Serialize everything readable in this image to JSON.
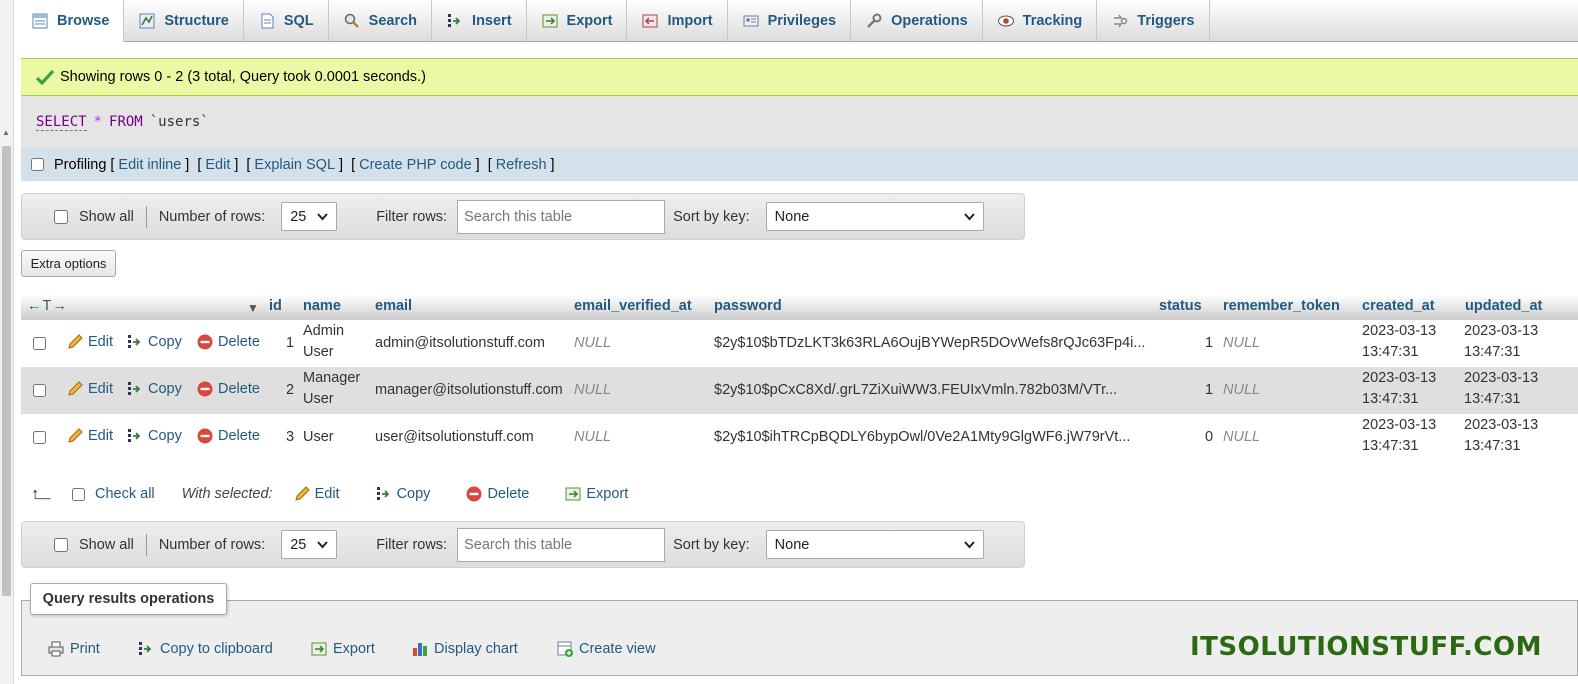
{
  "tabs": [
    {
      "label": "Browse",
      "icon": "browse-icon",
      "active": true
    },
    {
      "label": "Structure",
      "icon": "structure-icon"
    },
    {
      "label": "SQL",
      "icon": "sql-icon"
    },
    {
      "label": "Search",
      "icon": "search-icon"
    },
    {
      "label": "Insert",
      "icon": "insert-icon"
    },
    {
      "label": "Export",
      "icon": "export-icon"
    },
    {
      "label": "Import",
      "icon": "import-icon"
    },
    {
      "label": "Privileges",
      "icon": "privileges-icon"
    },
    {
      "label": "Operations",
      "icon": "operations-icon"
    },
    {
      "label": "Tracking",
      "icon": "tracking-icon"
    },
    {
      "label": "Triggers",
      "icon": "triggers-icon"
    }
  ],
  "success": {
    "message": "Showing rows 0 - 2 (3 total, Query took 0.0001 seconds.)",
    "color": "#ebf8a4"
  },
  "sql": {
    "select": "SELECT",
    "star": "*",
    "from": "FROM",
    "table": "`users`"
  },
  "profiling": {
    "label": "Profiling",
    "open": "[",
    "close": "]",
    "links": {
      "edit_inline": "Edit inline",
      "edit": "Edit",
      "explain": "Explain SQL",
      "php": "Create PHP code",
      "refresh": "Refresh"
    }
  },
  "nav": {
    "show_all": "Show all",
    "num_rows_label": "Number of rows:",
    "num_rows_value": "25",
    "filter_label": "Filter rows:",
    "filter_placeholder": "Search this table",
    "sort_label": "Sort by key:",
    "sort_value": "None"
  },
  "extra_options": "Extra options",
  "table": {
    "arrows": "←T→",
    "sort_marker": "▼",
    "columns": {
      "id": "id",
      "name": "name",
      "email": "email",
      "email_verified_at": "email_verified_at",
      "password": "password",
      "status": "status",
      "remember_token": "remember_token",
      "created_at": "created_at",
      "updated_at": "updated_at"
    },
    "actions": {
      "edit": "Edit",
      "copy": "Copy",
      "delete": "Delete"
    },
    "rows": [
      {
        "id": "1",
        "name_l1": "Admin",
        "name_l2": "User",
        "email": "admin@itsolutionstuff.com",
        "email_verified_at": "NULL",
        "password": "$2y$10$bTDzLKT3k63RLA6OujBYWepR5DOvWefs8rQJc63Fp4i...",
        "status": "1",
        "remember_token": "NULL",
        "created_date": "2023-03-13",
        "created_time": "13:47:31",
        "updated_date": "2023-03-13",
        "updated_time": "13:47:31"
      },
      {
        "id": "2",
        "name_l1": "Manager",
        "name_l2": "User",
        "email": "manager@itsolutionstuff.com",
        "email_verified_at": "NULL",
        "password": "$2y$10$pCxC8Xd/.grL7ZiXuiWW3.FEUIxVmln.782b03M/VTr...",
        "status": "1",
        "remember_token": "NULL",
        "created_date": "2023-03-13",
        "created_time": "13:47:31",
        "updated_date": "2023-03-13",
        "updated_time": "13:47:31"
      },
      {
        "id": "3",
        "name_l1": "User",
        "name_l2": "",
        "email": "user@itsolutionstuff.com",
        "email_verified_at": "NULL",
        "password": "$2y$10$ihTRCpBQDLY6bypOwl/0Ve2A1Mty9GlgWF6.jW79rVt...",
        "status": "0",
        "remember_token": "NULL",
        "created_date": "2023-03-13",
        "created_time": "13:47:31",
        "updated_date": "2023-03-13",
        "updated_time": "13:47:31"
      }
    ]
  },
  "with_selected": {
    "check_all": "Check all",
    "label": "With selected:",
    "edit": "Edit",
    "copy": "Copy",
    "delete": "Delete",
    "export": "Export"
  },
  "query_ops": {
    "legend": "Query results operations",
    "print": "Print",
    "clipboard": "Copy to clipboard",
    "export": "Export",
    "chart": "Display chart",
    "view": "Create view"
  },
  "watermark": "ITSOLUTIONSTUFF.COM",
  "colors": {
    "link": "#235a81",
    "success_border": "#a2d246",
    "profiling_bg": "#d5e1ea",
    "row_alt": "#dfdfdf",
    "watermark": "#2c6a12"
  }
}
